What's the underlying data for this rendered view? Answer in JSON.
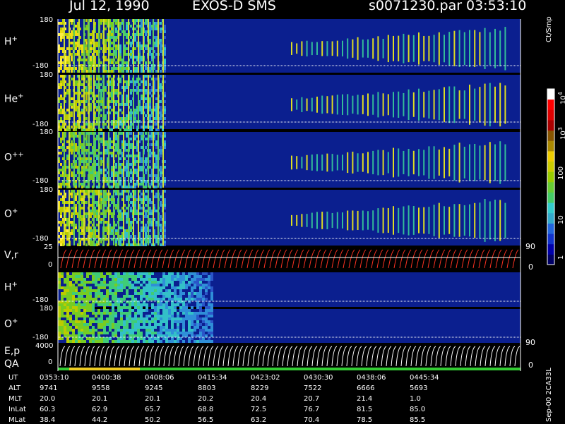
{
  "header": {
    "date": "Jul 12, 1990",
    "instrument": "EXOS-D SMS",
    "file": "s0071230.par",
    "time": "03:53:10"
  },
  "panels": [
    {
      "label": "H",
      "sup": "+",
      "ymax": "180",
      "ymin": "-180"
    },
    {
      "label": "He",
      "sup": "+",
      "ymax": "180",
      "ymin": "-180"
    },
    {
      "label": "O",
      "sup": "++",
      "ymax": "180",
      "ymin": "-180"
    },
    {
      "label": "O",
      "sup": "+",
      "ymax": "180",
      "ymin": "-180"
    },
    {
      "label": "V,r",
      "sup": "",
      "ymax": "25",
      "ymin": "0",
      "rmax": "90",
      "rmin": "0"
    },
    {
      "label": "H",
      "sup": "+",
      "ymax": "180",
      "ymin": "-180"
    },
    {
      "label": "O",
      "sup": "+",
      "ymax": "180",
      "ymin": "-180"
    },
    {
      "label": "E,p",
      "sup": "",
      "label2": "QA",
      "ymax": "4000",
      "ymin": "0",
      "rmax": "90",
      "rmin": "0"
    }
  ],
  "colorbar": {
    "unit": "Ct/Smp",
    "ticks": [
      "1",
      "10",
      "100",
      "10",
      "10"
    ],
    "tick_exp": [
      "",
      "",
      "",
      "3",
      "4"
    ],
    "colors": [
      "#000066",
      "#0000aa",
      "#1133cc",
      "#2266dd",
      "#33aacc",
      "#33cccc",
      "#44cc66",
      "#66cc33",
      "#99cc00",
      "#cccc00",
      "#eecc00",
      "#aa8800",
      "#885500",
      "#aa0000",
      "#dd0000",
      "#ff0000",
      "#ffffff"
    ]
  },
  "time_axis": {
    "rows": [
      {
        "name": "UT",
        "values": [
          "0353:10",
          "0400:38",
          "0408:06",
          "0415:34",
          "0423:02",
          "0430:30",
          "0438:06",
          "0445:34"
        ]
      },
      {
        "name": "ALT",
        "values": [
          "9741",
          "9558",
          "9245",
          "8803",
          "8229",
          "7522",
          "6666",
          "5693"
        ]
      },
      {
        "name": "MLT",
        "values": [
          "20.0",
          "20.1",
          "20.1",
          "20.2",
          "20.4",
          "20.7",
          "21.4",
          "1.0"
        ]
      },
      {
        "name": "InLat",
        "values": [
          "60.3",
          "62.9",
          "65.7",
          "68.8",
          "72.5",
          "76.7",
          "81.5",
          "85.0"
        ]
      },
      {
        "name": "MLat",
        "values": [
          "38.4",
          "44.2",
          "50.2",
          "56.5",
          "63.2",
          "70.4",
          "78.5",
          "85.5"
        ]
      }
    ]
  },
  "footer": "Sep-00 2CA33L",
  "chart_data": {
    "type": "heatmap",
    "title": "Jul 12, 1990  EXOS-D SMS",
    "x_ticks": [
      "0353:10",
      "0400:38",
      "0408:06",
      "0415:34",
      "0423:02",
      "0430:30",
      "0438:06",
      "0445:34"
    ],
    "panels": [
      {
        "label": "H+",
        "ylim": [
          -180,
          180
        ]
      },
      {
        "label": "He+",
        "ylim": [
          -180,
          180
        ]
      },
      {
        "label": "O++",
        "ylim": [
          -180,
          180
        ]
      },
      {
        "label": "O+",
        "ylim": [
          -180,
          180
        ]
      },
      {
        "label": "V,r",
        "ylim": [
          0,
          25
        ],
        "right_ylim": [
          0,
          90
        ]
      },
      {
        "label": "H+",
        "ylim": [
          -180,
          180
        ]
      },
      {
        "label": "O+",
        "ylim": [
          -180,
          180
        ]
      },
      {
        "label": "E,p",
        "ylim": [
          0,
          4000
        ],
        "right_ylim": [
          0,
          90
        ]
      }
    ],
    "colorbar_unit": "Ct/Smp",
    "colorbar_ticks": [
      "1",
      "10",
      "100",
      "10^3",
      "10^4"
    ]
  }
}
